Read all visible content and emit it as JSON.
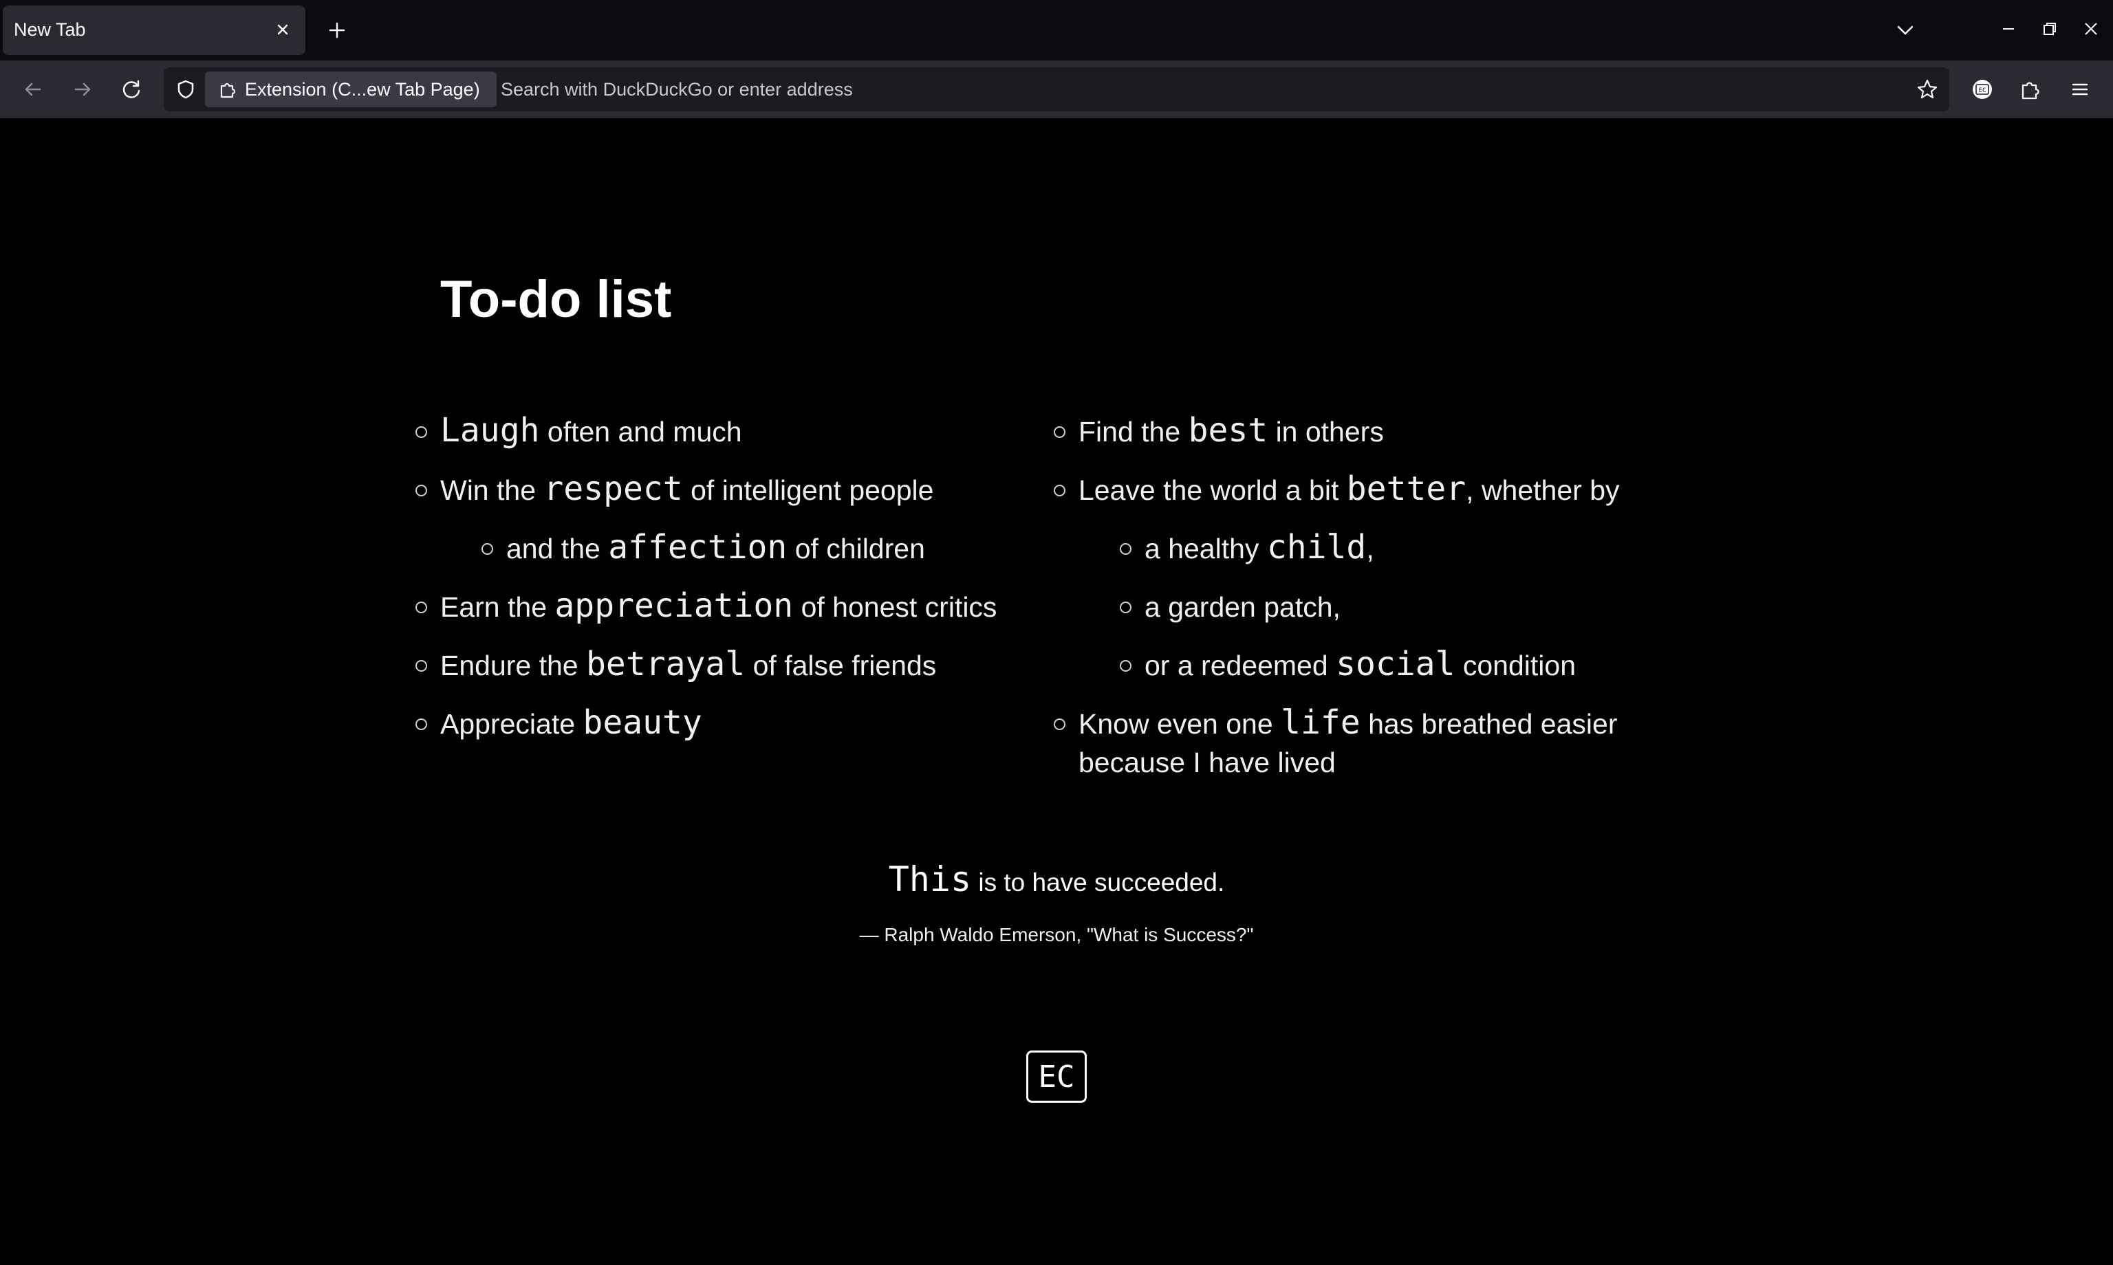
{
  "tab": {
    "title": "New Tab"
  },
  "urlbar": {
    "identity_label": "Extension (C...ew Tab Page)",
    "placeholder": "Search with DuckDuckGo or enter address"
  },
  "toolbar": {
    "extension_badge": "EC"
  },
  "page": {
    "heading": "To-do list",
    "left_items": [
      {
        "pre": "",
        "word": "Laugh",
        "post": "often and much"
      },
      {
        "pre": "Win the",
        "word": "respect",
        "post": "of intelligent people"
      },
      {
        "pre": "and the",
        "word": "affection",
        "post": "of children"
      },
      {
        "pre": "Earn the",
        "word": "appreciation",
        "post": "of honest critics"
      },
      {
        "pre": "Endure the",
        "word": "betrayal",
        "post": "of false friends"
      },
      {
        "pre": "Appreciate",
        "word": "beauty",
        "post": ""
      }
    ],
    "right_items": [
      {
        "pre": "Find the",
        "word": "best",
        "post": "in others"
      },
      {
        "pre": "Leave the world a bit",
        "word": "better",
        "post": ", whether by"
      },
      {
        "pre": "a healthy",
        "word": "child",
        "post": ","
      },
      {
        "pre": "a garden patch,",
        "word": "",
        "post": ""
      },
      {
        "pre": "or a redeemed",
        "word": "social",
        "post": "condition"
      },
      {
        "pre": "Know even one",
        "word": "life",
        "post": "has breathed easier because I have lived"
      }
    ],
    "quote": {
      "word": "This",
      "rest": "is to have succeeded."
    },
    "attribution": "— Ralph Waldo Emerson, \"What is Success?\"",
    "logo": "EC"
  }
}
